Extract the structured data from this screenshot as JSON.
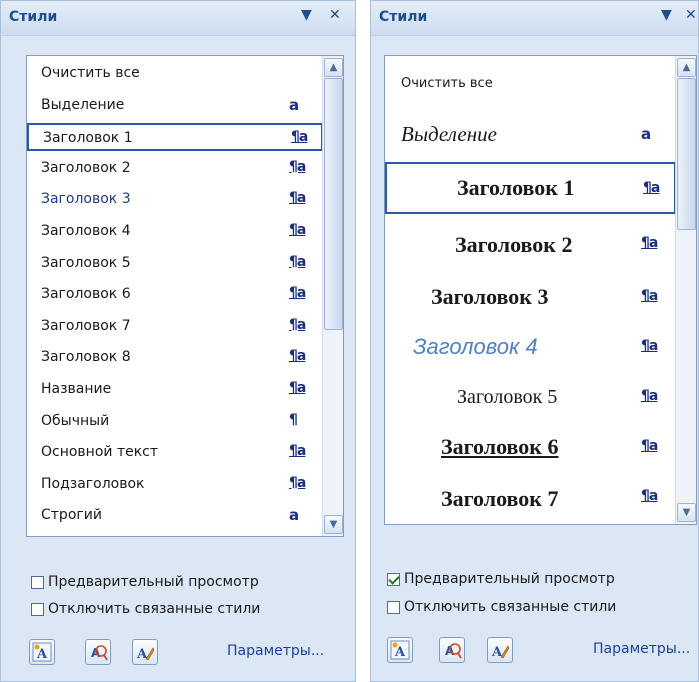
{
  "left_pane": {
    "title": "Стили",
    "dropdown_glyph": "▼",
    "close_glyph": "✕",
    "items": [
      {
        "label": "Очистить все",
        "glyph": ""
      },
      {
        "label": "Выделение",
        "glyph": "a"
      },
      {
        "label": "Заголовок 1",
        "glyph": "¶a",
        "selected": true
      },
      {
        "label": "Заголовок 2",
        "glyph": "¶a"
      },
      {
        "label": "Заголовок 3",
        "glyph": "¶a"
      },
      {
        "label": "Заголовок 4",
        "glyph": "¶a"
      },
      {
        "label": "Заголовок 5",
        "glyph": "¶a"
      },
      {
        "label": "Заголовок 6",
        "glyph": "¶a"
      },
      {
        "label": "Заголовок 7",
        "glyph": "¶a"
      },
      {
        "label": "Заголовок 8",
        "glyph": "¶a"
      },
      {
        "label": "Название",
        "glyph": "¶a"
      },
      {
        "label": "Обычный",
        "glyph": "¶"
      },
      {
        "label": "Основной текст",
        "glyph": "¶a"
      },
      {
        "label": "Подзаголовок",
        "glyph": "¶a"
      },
      {
        "label": "Строгий",
        "glyph": "a"
      }
    ],
    "preview_label": "Предварительный просмотр",
    "preview_checked": false,
    "linked_label": "Отключить связанные стили",
    "linked_checked": false,
    "params_label": "Параметры..."
  },
  "right_pane": {
    "title": "Стили",
    "dropdown_glyph": "▼",
    "close_glyph": "✕",
    "items": [
      {
        "label": "Очистить все",
        "glyph": ""
      },
      {
        "label": "Выделение",
        "glyph": "a"
      },
      {
        "label": "Заголовок 1",
        "glyph": "¶a",
        "selected": true
      },
      {
        "label": "Заголовок 2",
        "glyph": "¶a"
      },
      {
        "label": "Заголовок 3",
        "glyph": "¶a"
      },
      {
        "label": "Заголовок 4",
        "glyph": "¶a"
      },
      {
        "label": "Заголовок 5",
        "glyph": "¶a"
      },
      {
        "label": "Заголовок 6",
        "glyph": "¶a"
      },
      {
        "label": "Заголовок 7",
        "glyph": "¶a"
      }
    ],
    "preview_label": "Предварительный просмотр",
    "preview_checked": true,
    "linked_label": "Отключить связанные стили",
    "linked_checked": false,
    "params_label": "Параметры..."
  },
  "colors": {
    "heading4_blue": "#4f81bd",
    "heading3_color": "#1f3a80",
    "accent": "#1f4e8c"
  },
  "icons": {
    "new_style": "new-style-icon",
    "style_inspector": "style-inspector-icon",
    "manage_styles": "manage-styles-icon",
    "scroll_up": "scroll-up-icon",
    "scroll_down": "scroll-down-icon"
  }
}
